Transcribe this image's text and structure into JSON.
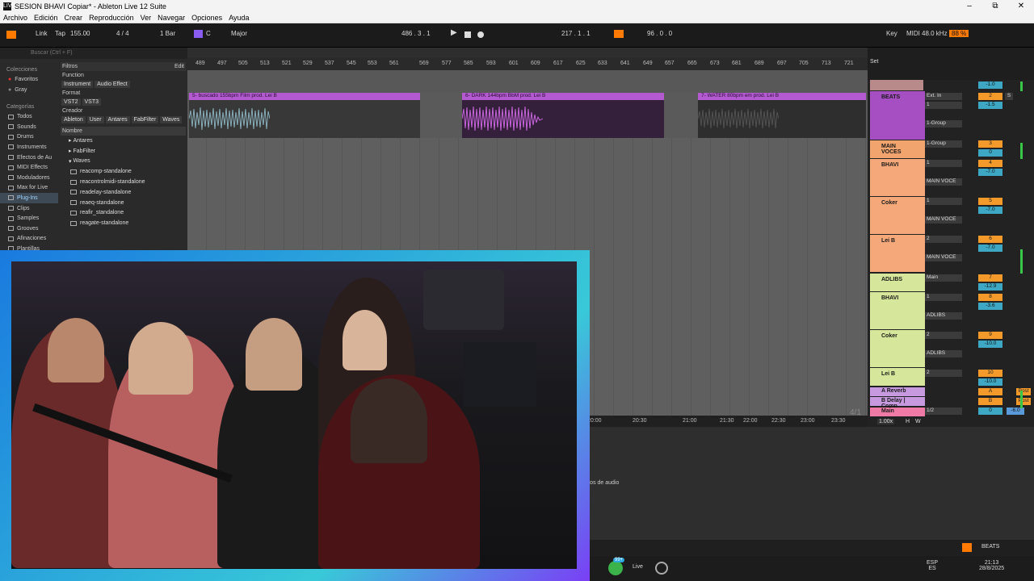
{
  "window": {
    "title": "SESION BHAVI Copiar* - Ableton Live 12 Suite",
    "logo_text": "LIVE",
    "minimize": "–",
    "maximize": "⧉",
    "close": "✕"
  },
  "menu": [
    "Archivo",
    "Edición",
    "Crear",
    "Reproducción",
    "Ver",
    "Navegar",
    "Opciones",
    "Ayuda"
  ],
  "control": {
    "link": "Link",
    "tap": "Tap",
    "tempo": "155.00",
    "signature": "4 / 4",
    "quantize": "1 Bar",
    "key": "C",
    "scale": "Major",
    "position": "486 .  3 .  1",
    "loop_start": "217 .  1 .  1",
    "loop_length": "96 .  0 .  0",
    "key_label": "Key",
    "midi_label": "MIDI",
    "sample_rate": "48.0 kHz",
    "cpu": "88 %"
  },
  "browser": {
    "search_placeholder": "Buscar (Ctrl + F)",
    "collections_header": "Colecciones",
    "collections": [
      "Favoritos",
      "Gray"
    ],
    "categories_header": "Categorías",
    "categories": [
      "Todos",
      "Sounds",
      "Drums",
      "Instruments",
      "Efectos de Au",
      "MIDI Effects",
      "Moduladores",
      "Max for Live",
      "Plug-Ins",
      "Clips",
      "Samples",
      "Grooves",
      "Afinaciones",
      "Plantillas"
    ],
    "filters_label": "Filtros",
    "edit_label": "Edit",
    "function_label": "Function",
    "function_chips": [
      "Instrument",
      "Audio Effect"
    ],
    "format_label": "Format",
    "format_chips": [
      "VST2",
      "VST3"
    ],
    "creator_label": "Creador",
    "creator_chips": [
      "Ableton",
      "User",
      "Antares",
      "FabFilter",
      "Waves"
    ],
    "name_header": "Nombre",
    "folders": [
      "Antares",
      "FabFilter",
      "Waves"
    ],
    "plugins": [
      "reacomp-standalone",
      "reacontrolmidi-standalone",
      "readelay-standalone",
      "reaeq-standalone",
      "reafir_standalone",
      "reagate-standalone"
    ]
  },
  "ruler": [
    "489",
    "497",
    "505",
    "513",
    "521",
    "529",
    "537",
    "545",
    "553",
    "561",
    "569",
    "577",
    "585",
    "593",
    "601",
    "609",
    "617",
    "625",
    "633",
    "641",
    "649",
    "657",
    "665",
    "673",
    "681",
    "689",
    "697",
    "705",
    "713",
    "721"
  ],
  "clips": [
    {
      "name": "5- buscado 155bpm Film prod. Lei B"
    },
    {
      "name": "6- DARK 144bpm BbM prod. Lei B"
    },
    {
      "name": "7- WATER 80bpm em prod. Lei B"
    }
  ],
  "set_label": "Set",
  "arrangement_meter": "4/1",
  "tracks": [
    {
      "name": "BEATS",
      "input": "Ext. In",
      "ch": "1",
      "out": "1-Group",
      "num": "2",
      "vol": "-1.5",
      "pan": "C"
    },
    {
      "name": "MAIN VOCES",
      "input": "1-Group",
      "num": "3",
      "vol": "0",
      "pan": "C"
    },
    {
      "name": "BHAVI",
      "ch": "1",
      "out": "MAIN VOCE",
      "num": "4",
      "vol": "-7.0",
      "pan": "C"
    },
    {
      "name": "Coker",
      "ch": "1",
      "out": "MAIN VOCE",
      "num": "5",
      "vol": "-7.0",
      "pan": "C"
    },
    {
      "name": "Lei B",
      "ch": "2",
      "out": "MAIN VOCE",
      "num": "6",
      "vol": "-7.0",
      "pan": "C"
    },
    {
      "name": "ADLIBS",
      "input": "Main",
      "num": "7",
      "vol": "-12.9",
      "pan": "C"
    },
    {
      "name": "BHAVI",
      "ch": "1",
      "out": "ADLIBS",
      "num": "8",
      "vol": "-3.6",
      "pan": "C"
    },
    {
      "name": "Coker",
      "ch": "2",
      "out": "ADLIBS",
      "num": "9",
      "vol": "-10.0",
      "pan": "C"
    },
    {
      "name": "Lei B",
      "ch": "2",
      "num": "10",
      "vol": "-10.0",
      "pan": "C"
    },
    {
      "name": "A Reverb",
      "num": "A",
      "send": "Post"
    },
    {
      "name": "B Delay | Comp",
      "num": "B",
      "send": "Post"
    },
    {
      "name": "Main",
      "out": "1/2",
      "num": "0",
      "vol": "-6.0"
    }
  ],
  "mixer_common": {
    "in": "In",
    "auto": "Auto",
    "off": "Off",
    "s": "S",
    "inf": "-∞",
    "top_vol": "-1.0"
  },
  "timeline2": [
    "20:00",
    "20:30",
    "21:00",
    "21:30",
    "22:00",
    "22:30",
    "23:00",
    "23:30"
  ],
  "zoom": "1.00x",
  "hw": [
    "H",
    "W"
  ],
  "lower_text": "efectos de audio",
  "bottom_track": "BEATS",
  "taskbar": {
    "badge": "99+",
    "live": "Live",
    "lang1": "ESP",
    "lang2": "ES",
    "time": "21:13",
    "date": "28/8/2025"
  },
  "colors": {
    "accent": "#ff7a00",
    "clip": "#b35ad0",
    "group_beats": "#a54fc2",
    "vocals": "#f5a97a",
    "adlibs": "#d6e69a"
  }
}
